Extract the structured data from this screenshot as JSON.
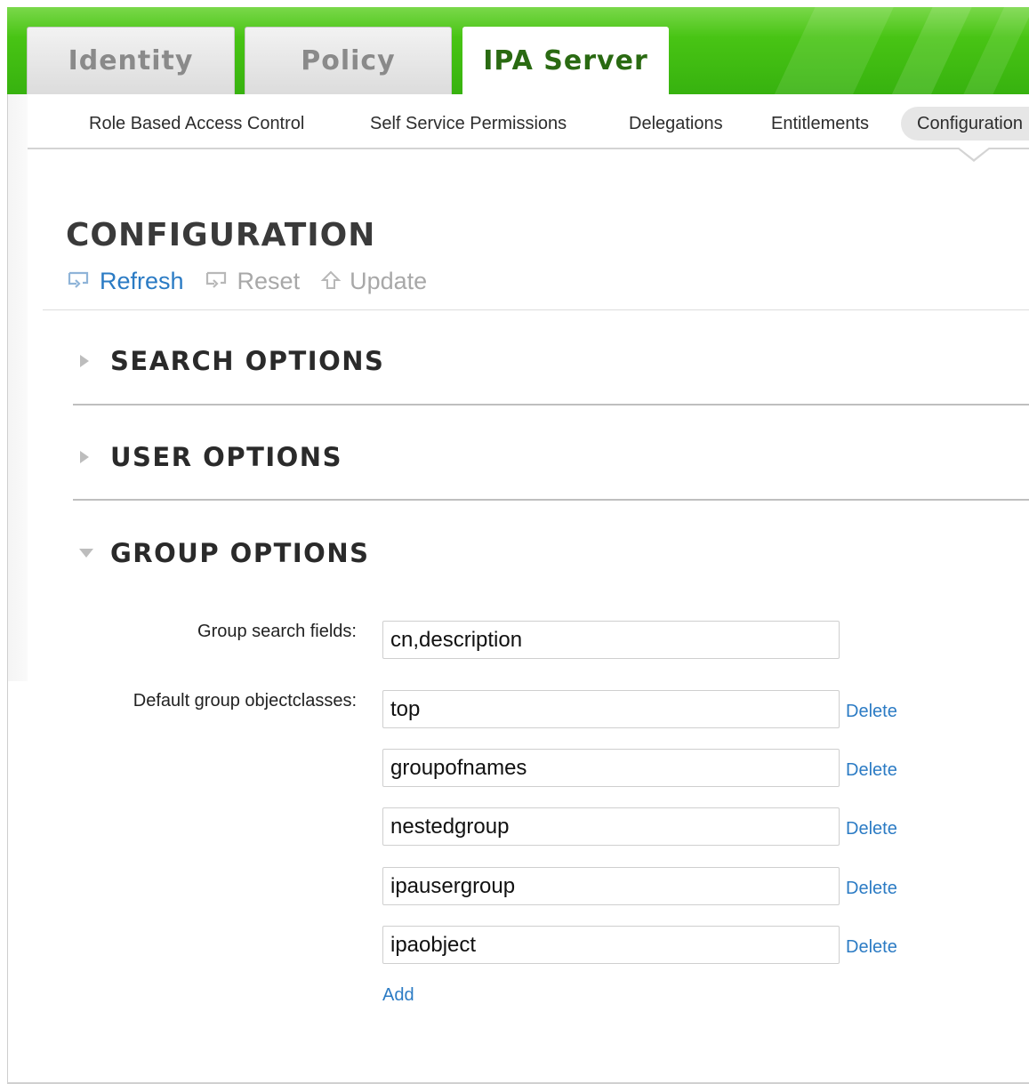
{
  "top_tabs": [
    {
      "label": "Identity",
      "active": false
    },
    {
      "label": "Policy",
      "active": false
    },
    {
      "label": "IPA Server",
      "active": true
    }
  ],
  "sub_nav": [
    {
      "label": "Role Based Access Control"
    },
    {
      "label": "Self Service Permissions"
    },
    {
      "label": "Delegations"
    },
    {
      "label": "Entitlements"
    },
    {
      "label": "Configuration",
      "selected": true
    }
  ],
  "page": {
    "title": "CONFIGURATION",
    "actions": {
      "refresh": "Refresh",
      "reset": "Reset",
      "update": "Update"
    }
  },
  "sections": [
    {
      "title": "SEARCH OPTIONS",
      "expanded": false
    },
    {
      "title": "USER OPTIONS",
      "expanded": false
    },
    {
      "title": "GROUP OPTIONS",
      "expanded": true
    }
  ],
  "group_options": {
    "search_fields_label": "Group search fields:",
    "search_fields_value": "cn,description",
    "objectclasses_label": "Default group objectclasses:",
    "objectclasses": [
      "top",
      "groupofnames",
      "nestedgroup",
      "ipausergroup",
      "ipaobject"
    ],
    "delete_label": "Delete",
    "add_label": "Add"
  },
  "colors": {
    "brand_green": "#37b20f",
    "link_blue": "#2b7bc4",
    "disabled_gray": "#a8a8a8"
  },
  "icons": {
    "refresh": "refresh-icon",
    "reset": "reset-icon",
    "update": "update-arrow-icon",
    "collapsed": "triangle-right-icon",
    "expanded": "triangle-down-icon"
  }
}
